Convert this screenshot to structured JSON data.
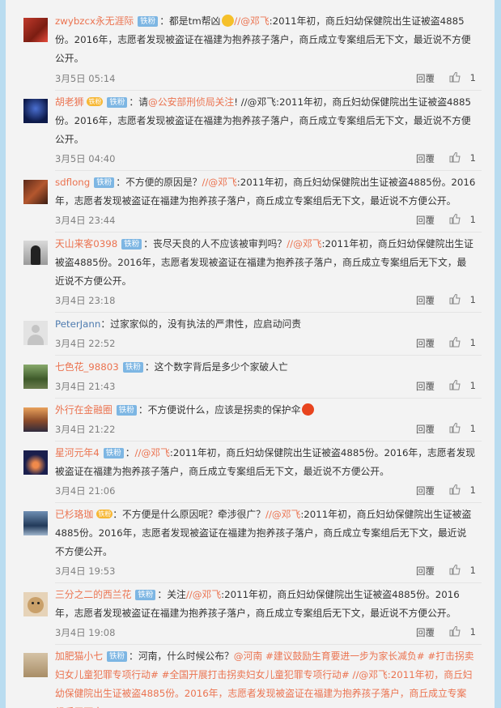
{
  "shared_quote": "//@邓飞:2011年初，商丘妇幼保健院出生证被盗4885份。2016年，志愿者发现被盗证在福建为抱养孩子落户，商丘成立专案组后无下文，最近说不方便公开。",
  "labels": {
    "reply": "回覆",
    "badge": "铁粉",
    "vip": "铁粉"
  },
  "comments": [
    {
      "user": "zwybzcx永无涯际",
      "text": "：都是tm帮凶",
      "mention": "//@邓飞",
      "rest": ":2011年初，商丘妇幼保健院出生证被盗4885份。2016年，志愿者发现被盗证在福建为抱养孩子落户，商丘成立专案组后无下文，最近说不方便公开。",
      "time": "3月5日 05:14",
      "count": "1"
    },
    {
      "user": "胡老狮",
      "text": "：请",
      "mention": "@公安部刑侦局关注",
      "rest": "! //@邓飞:2011年初，商丘妇幼保健院出生证被盗4885份。2016年，志愿者发现被盗证在福建为抱养孩子落户，商丘成立专案组后无下文，最近说不方便公开。",
      "time": "3月5日 04:40",
      "count": "1"
    },
    {
      "user": "sdflong",
      "text": "：不方便的原因是？",
      "mention": "//@邓飞",
      "rest": ":2011年初，商丘妇幼保健院出生证被盗4885份。2016年，志愿者发现被盗证在福建为抱养孩子落户，商丘成立专案组后无下文，最近说不方便公开。",
      "time": "3月4日 23:44",
      "count": "1"
    },
    {
      "user": "天山来客0398",
      "text": "：丧尽天良的人不应该被审判吗？",
      "mention": "//@邓飞",
      "rest": ":2011年初，商丘妇幼保健院出生证被盗4885份。2016年，志愿者发现被盗证在福建为抱养孩子落户，商丘成立专案组后无下文，最近说不方便公开。",
      "time": "3月4日 23:18",
      "count": "1"
    },
    {
      "user": "PeterJann",
      "text": "：过家家似的，没有执法的严肃性，应启动问责",
      "mention": "",
      "rest": "",
      "time": "3月4日 22:52",
      "count": "1"
    },
    {
      "user": "七色花_98803",
      "text": "：这个数字背后是多少个家破人亡",
      "mention": "",
      "rest": "",
      "time": "3月4日 21:43",
      "count": "1"
    },
    {
      "user": "外行在金融圈",
      "text": "：不方便说什么，应该是拐卖的保护伞",
      "mention": "",
      "rest": "",
      "time": "3月4日 21:22",
      "count": "1"
    },
    {
      "user": "星河元年4",
      "text": "：",
      "mention": "//@邓飞",
      "rest": ":2011年初，商丘妇幼保健院出生证被盗4885份。2016年，志愿者发现被盗证在福建为抱养孩子落户，商丘成立专案组后无下文，最近说不方便公开。",
      "time": "3月4日 21:06",
      "count": "1"
    },
    {
      "user": "已杉珞珈",
      "text": "：不方便是什么原因呢？牵涉很广？",
      "mention": "//@邓飞",
      "rest": ":2011年初，商丘妇幼保健院出生证被盗4885份。2016年，志愿者发现被盗证在福建为抱养孩子落户，商丘成立专案组后无下文，最近说不方便公开。",
      "time": "3月4日 19:53",
      "count": "1"
    },
    {
      "user": "三分之二的西兰花",
      "text": "：关注",
      "mention": "//@邓飞",
      "rest": ":2011年初，商丘妇幼保健院出生证被盗4885份。2016年，志愿者发现被盗证在福建为抱养孩子落户，商丘成立专案组后无下文，最近说不方便公开。",
      "time": "3月4日 19:08",
      "count": "1"
    },
    {
      "user": "加肥猫小七",
      "text": "：河南，什么时候公布？",
      "mention": "@河南",
      "rest": " #建议鼓励生育要进一步为家长减负# #打击拐卖妇女儿童犯罪专项行动# #全国开展打击拐卖妇女儿童犯罪专项行动# //@邓飞:2011年初，商丘妇幼保健院出生证被盗4885份。2016年，志愿者发现被盗证在福建为抱养孩子落户，商丘成立专案组后无下文，",
      "time": "",
      "count": ""
    }
  ]
}
